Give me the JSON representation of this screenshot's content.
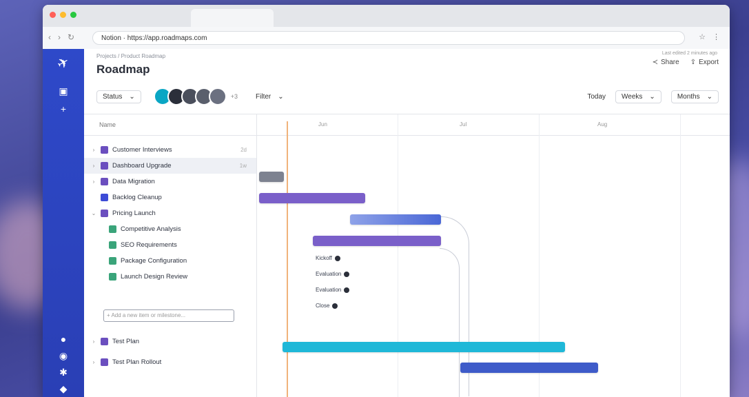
{
  "browser": {
    "tab_title": "",
    "url": "Notion · https://app.roadmaps.com",
    "window_dots": [
      "#ff5f57",
      "#febc2e",
      "#28c840"
    ]
  },
  "breadcrumb": "Projects / Product Roadmap",
  "page": {
    "title": "Roadmap",
    "top_label": "Last edited 2 minutes ago"
  },
  "actions": {
    "share_label": "Share",
    "export_label": "Export"
  },
  "toolbar": {
    "group_label": "Status",
    "extra_avatars": "+3",
    "filter_label": "Filter",
    "today_label": "Today",
    "view_label": "Weeks",
    "sort_label": "Months"
  },
  "avatar_colors": [
    "#0aa6c4",
    "#2b2f3a",
    "#4a4f5c",
    "#5a5f6c",
    "#6b7080"
  ],
  "tree": {
    "header": "Name",
    "rows": [
      {
        "label": "Customer Interviews",
        "chev": "›",
        "color": "#6b4fbf",
        "badge": "2d",
        "indent": 0
      },
      {
        "label": "Dashboard Upgrade",
        "chev": "›",
        "color": "#6b4fbf",
        "badge": "1w",
        "indent": 0
      },
      {
        "label": "Data Migration",
        "chev": "›",
        "color": "#6b4fbf",
        "badge": "",
        "indent": 0
      },
      {
        "label": "Backlog Cleanup",
        "chev": "",
        "color": "#3d4bd6",
        "badge": "",
        "indent": 0
      },
      {
        "label": "Pricing Launch",
        "chev": "⌄",
        "color": "#6b4fbf",
        "badge": "",
        "indent": 0
      },
      {
        "label": "Competitive Analysis",
        "chev": "",
        "color": "#3aa47a",
        "badge": "",
        "indent": 1
      },
      {
        "label": "SEO Requirements",
        "chev": "",
        "color": "#3aa47a",
        "badge": "",
        "indent": 1
      },
      {
        "label": "Package Configuration",
        "chev": "",
        "color": "#3aa47a",
        "badge": "",
        "indent": 1
      },
      {
        "label": "Launch Design Review",
        "chev": "",
        "color": "#3aa47a",
        "badge": "",
        "indent": 1
      }
    ],
    "new_row_placeholder": "+ Add a new item or milestone...",
    "bottom_rows": [
      {
        "label": "Test Plan",
        "chev": "›",
        "color": "#6b4fbf"
      },
      {
        "label": "Test Plan Rollout",
        "chev": "›",
        "color": "#6b4fbf"
      }
    ]
  },
  "timeline": {
    "months": [
      "Jun",
      "Jul",
      "Aug"
    ],
    "milestones": [
      "Kickoff",
      "Evaluation",
      "Evaluation",
      "Close"
    ]
  },
  "bar_colors": {
    "grey": "#7d8290",
    "purple": "#7a5fc9",
    "blue": "#4a67d6",
    "cyan": "#1fb8d8",
    "navy": "#3e5bc9"
  }
}
